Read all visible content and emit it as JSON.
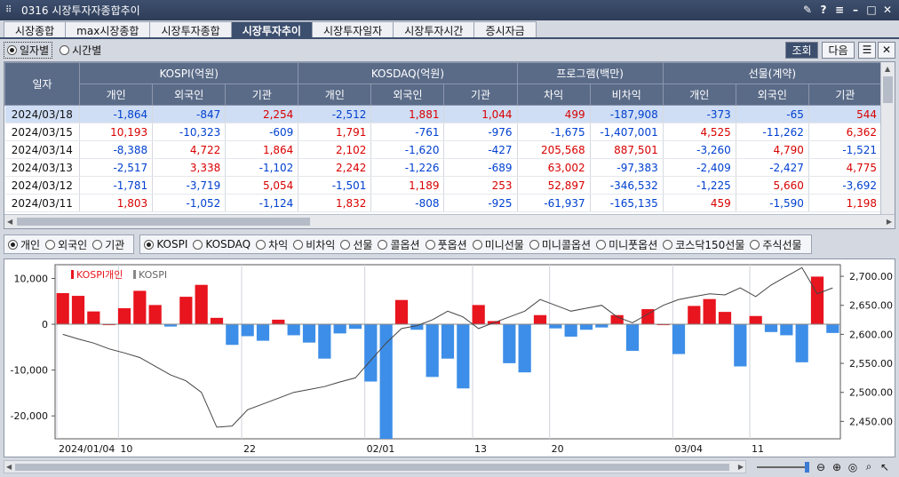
{
  "window": {
    "title": "0316 시장투자자종합추이"
  },
  "tabs": [
    "시장종합",
    "max시장종합",
    "시장투자종합",
    "시장투자추이",
    "시장투자일자",
    "시장투자시간",
    "증시자금"
  ],
  "active_tab": 3,
  "mode": {
    "daily": "일자별",
    "hourly": "시간별"
  },
  "buttons": {
    "query": "조회",
    "next": "다음"
  },
  "grid": {
    "date_header": "일자",
    "groups": [
      "KOSPI(억원)",
      "KOSDAQ(억원)",
      "프로그램(백만)",
      "선물(계약)"
    ],
    "sub_headers": [
      "개인",
      "외국인",
      "기관",
      "개인",
      "외국인",
      "기관",
      "차익",
      "비차익",
      "개인",
      "외국인",
      "기관"
    ],
    "rows": [
      {
        "date": "2024/03/18",
        "cells": [
          "-1,864",
          "-847",
          "2,254",
          "-2,512",
          "1,881",
          "1,044",
          "499",
          "-187,908",
          "-373",
          "-65",
          "544"
        ]
      },
      {
        "date": "2024/03/15",
        "cells": [
          "10,193",
          "-10,323",
          "-609",
          "1,791",
          "-761",
          "-976",
          "-1,675",
          "-1,407,001",
          "4,525",
          "-11,262",
          "6,362"
        ]
      },
      {
        "date": "2024/03/14",
        "cells": [
          "-8,388",
          "4,722",
          "1,864",
          "2,102",
          "-1,620",
          "-427",
          "205,568",
          "887,501",
          "-3,260",
          "4,790",
          "-1,521"
        ]
      },
      {
        "date": "2024/03/13",
        "cells": [
          "-2,517",
          "3,338",
          "-1,102",
          "2,242",
          "-1,226",
          "-689",
          "63,002",
          "-97,383",
          "-2,409",
          "-2,427",
          "4,775"
        ]
      },
      {
        "date": "2024/03/12",
        "cells": [
          "-1,781",
          "-3,719",
          "5,054",
          "-1,501",
          "1,189",
          "253",
          "52,897",
          "-346,532",
          "-1,225",
          "5,660",
          "-3,692"
        ]
      },
      {
        "date": "2024/03/11",
        "cells": [
          "1,803",
          "-1,052",
          "-1,124",
          "1,832",
          "-808",
          "-925",
          "-61,937",
          "-165,135",
          "459",
          "-1,590",
          "1,198"
        ]
      }
    ]
  },
  "investor_options": [
    "개인",
    "외국인",
    "기관"
  ],
  "market_options": [
    "KOSPI",
    "KOSDAQ",
    "차익",
    "비차익",
    "선물",
    "콜옵션",
    "풋옵션",
    "미니선물",
    "미니콜옵션",
    "미니풋옵션",
    "코스닥150선물",
    "주식선물"
  ],
  "chart_data": {
    "type": "bar",
    "legend": [
      "KOSPI개인",
      "KOSPI"
    ],
    "left_ticks": [
      "10,000",
      "0",
      "-10,000",
      "-20,000"
    ],
    "right_ticks": [
      "2,700.00",
      "2,650.00",
      "2,600.00",
      "2,550.00",
      "2,500.00",
      "2,450.00"
    ],
    "x_ticks": [
      {
        "index": 0,
        "label": "2024/01/04"
      },
      {
        "index": 4,
        "label": "10"
      },
      {
        "index": 12,
        "label": "22"
      },
      {
        "index": 20,
        "label": "02/01"
      },
      {
        "index": 27,
        "label": "13"
      },
      {
        "index": 32,
        "label": "20"
      },
      {
        "index": 40,
        "label": "03/04"
      },
      {
        "index": 45,
        "label": "11"
      }
    ],
    "bar_ylim": [
      -25000,
      13000
    ],
    "line_ylim": [
      2420,
      2720
    ],
    "bar_values": [
      6800,
      6200,
      2800,
      0,
      3500,
      7300,
      4200,
      -500,
      6000,
      8600,
      1400,
      -4500,
      -2600,
      -3600,
      1000,
      -2400,
      -4000,
      -7500,
      -2000,
      -1000,
      -12500,
      -25000,
      5300,
      -1200,
      -11500,
      -7500,
      -14000,
      4200,
      700,
      -8500,
      -10500,
      2000,
      -900,
      -2700,
      -1200,
      -700,
      2000,
      -5800,
      3300,
      0,
      -6500,
      4000,
      5500,
      2700,
      -9200,
      1800,
      -1700,
      -2400,
      -8300,
      10400,
      -1900
    ],
    "line_values": [
      2600,
      2592,
      2585,
      2575,
      2568,
      2560,
      2545,
      2530,
      2520,
      2500,
      2440,
      2442,
      2470,
      2480,
      2490,
      2500,
      2505,
      2510,
      2518,
      2525,
      2555,
      2585,
      2610,
      2615,
      2625,
      2640,
      2630,
      2610,
      2620,
      2630,
      2640,
      2660,
      2650,
      2640,
      2645,
      2650,
      2630,
      2620,
      2635,
      2650,
      2660,
      2665,
      2670,
      2668,
      2680,
      2665,
      2685,
      2700,
      2715,
      2670,
      2680
    ]
  }
}
